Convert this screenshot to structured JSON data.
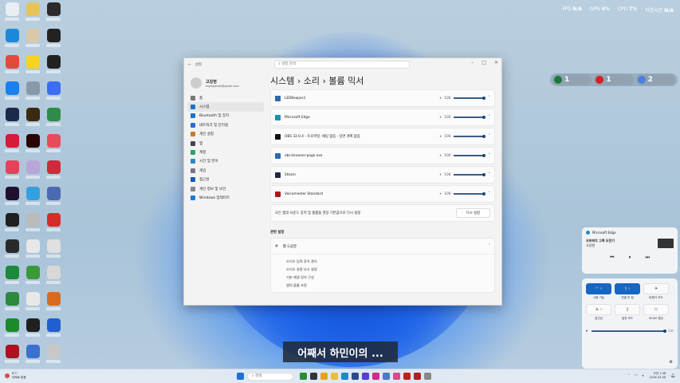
{
  "hud": {
    "fps_label": "FPS",
    "fps": "N/A",
    "gpu_label": "GPU",
    "gpu": "4%",
    "cpu_label": "CPU",
    "cpu": "7%",
    "time_label": "자연시간",
    "time": "N/A"
  },
  "pills": [
    {
      "count": "1",
      "color": "#1a7a3a"
    },
    {
      "count": "1",
      "color": "#d42020"
    },
    {
      "count": "2",
      "color": "#4a7ee0"
    }
  ],
  "desktop_icon_colors": [
    "#e9eef4",
    "#e6c35a",
    "#2b2b2b",
    "#1e88d8",
    "#d9c9a9",
    "#222",
    "#e24a3b",
    "#f7d21f",
    "#222",
    "#1b7ff0",
    "#8899aa",
    "#3b6ef5",
    "#1b2a4a",
    "#3a2a10",
    "#2e8b4a",
    "#d41b3a",
    "#2a0505",
    "#e84a5a",
    "#e8405a",
    "#b9a6d8",
    "#d02a3a",
    "#201030",
    "#35a0e0",
    "#4a6ab0",
    "#202020",
    "#bbb",
    "#d82a2a",
    "#2a2a2a",
    "#e8e8e8",
    "#e0e0e0",
    "#1c8a3a",
    "#3a9a3a",
    "#d8d8d8",
    "#2a8a3a",
    "#e8e8e8",
    "#d86a20",
    "#1a8a2a",
    "#202020",
    "#2060d0",
    "#b01020",
    "#3a70d0",
    "#c8c8c8"
  ],
  "settings": {
    "title": "설정",
    "search_placeholder": "설정 검색",
    "user": {
      "name": "고강현",
      "email": "mgurganist@gmail.com"
    },
    "nav": [
      {
        "label": "홈",
        "color": "#777"
      },
      {
        "label": "시스템",
        "color": "#1a73c8"
      },
      {
        "label": "Bluetooth 및 장치",
        "color": "#1a73c8"
      },
      {
        "label": "네트워크 및 인터넷",
        "color": "#2a6ad8"
      },
      {
        "label": "개인 설정",
        "color": "#c87a2a"
      },
      {
        "label": "앱",
        "color": "#445"
      },
      {
        "label": "계정",
        "color": "#2aa06a"
      },
      {
        "label": "시간 및 언어",
        "color": "#2a8ac8"
      },
      {
        "label": "게임",
        "color": "#778"
      },
      {
        "label": "접근성",
        "color": "#1a5ab8"
      },
      {
        "label": "개인 정보 및 보안",
        "color": "#888"
      },
      {
        "label": "Windows 업데이트",
        "color": "#1a7ad8"
      }
    ],
    "breadcrumb": "시스템  ›  소리  ›  볼륨 믹서",
    "apps": [
      {
        "name": "LEDKeeper2",
        "volume": "100",
        "color": "#2a6ab0"
      },
      {
        "name": "Microsoft Edge",
        "volume": "100",
        "color": "#1c8fb8"
      },
      {
        "name": "OBS 32.0.4 - 프로파일: 채팅 없음 - 장면 계획 없음",
        "volume": "100",
        "color": "#111"
      },
      {
        "name": "obs-browser-page.exe",
        "volume": "100",
        "color": "#2a6ab0"
      },
      {
        "name": "Steam",
        "volume": "100",
        "color": "#1b2a4a"
      },
      {
        "name": "Voicemeeter Standard",
        "volume": "100",
        "color": "#b01818"
      }
    ],
    "reset_text": "모든 앱의 사운드 장치 및 볼륨을 권장 기본값으로 다시 설정",
    "reset_button": "다시 설정",
    "related_title": "관련 설정",
    "help_title": "웹 도움말",
    "help_links": [
      "오디오 입력 장치 관리",
      "오디오 설정 다시 설정",
      "기본 재생 장치 구성",
      "앱의 볼륨 조정"
    ]
  },
  "subtitle": "어째서 하민이의 ...",
  "media": {
    "app": "Microsoft Edge",
    "title": "오버워치 그렉 도전기",
    "artist": "고강현"
  },
  "quick": {
    "tiles": [
      {
        "label": "사용 가능",
        "on": true,
        "icon": "wifi"
      },
      {
        "label": "연결 안 됨",
        "on": true,
        "icon": "bluetooth"
      },
      {
        "label": "비행기 모드",
        "on": false,
        "icon": "airplane"
      },
      {
        "label": "접근성",
        "on": false,
        "icon": "accessibility"
      },
      {
        "label": "절전 모드",
        "on": false,
        "icon": "battery-saver"
      },
      {
        "label": "라이브 캡션",
        "on": false,
        "icon": "captions"
      }
    ],
    "volume_percent": 100
  },
  "taskbar": {
    "weather": "8°C",
    "weather_sub": "대체로 맑음",
    "search": "검색",
    "time": "오전 1:38",
    "date": "2026-03-08",
    "app_colors": [
      "#2a8a3a",
      "#333",
      "#e8a020",
      "#e8c040",
      "#1a8ac8",
      "#2a4a8a",
      "#5a3ad8",
      "#d02a8a",
      "#4a7ac8",
      "#d84a8a",
      "#c02020",
      "#b02020",
      "#888"
    ]
  }
}
